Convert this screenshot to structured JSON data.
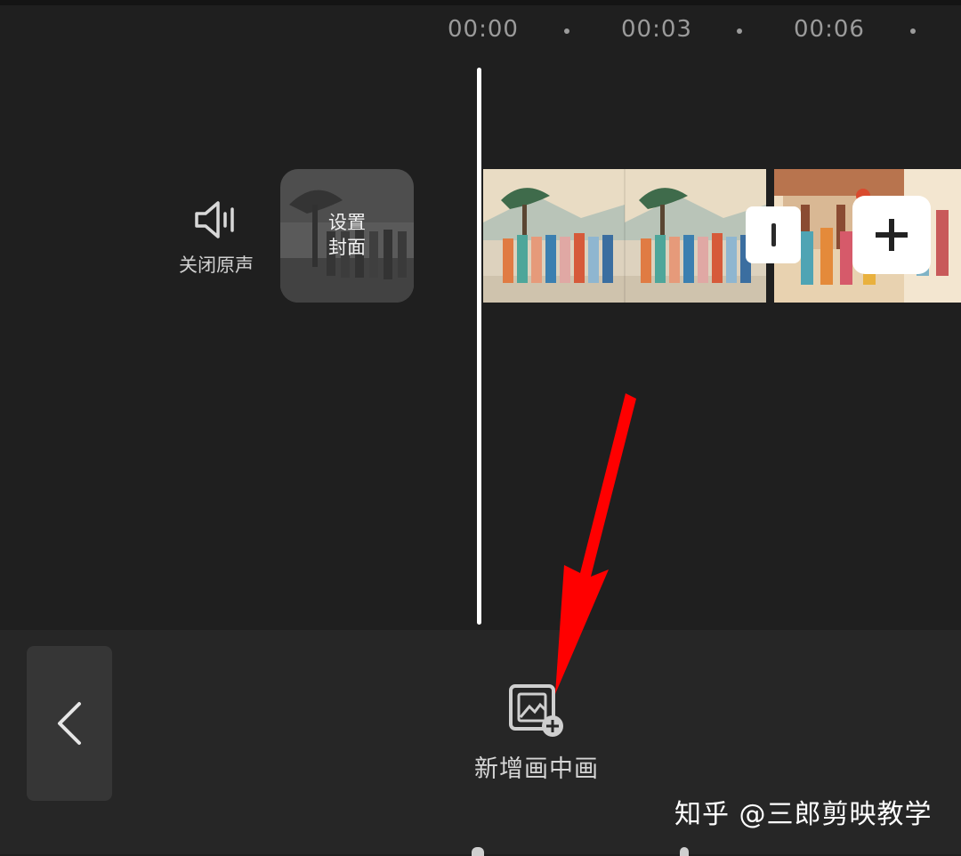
{
  "timeline": {
    "ticks": [
      "00:00",
      "00:03",
      "00:06"
    ]
  },
  "track_controls": {
    "mute_label": "关闭原声",
    "mute_icon": "speaker-icon",
    "cover_label_line1": "设置",
    "cover_label_line2": "封面"
  },
  "clips": {
    "transition_icon": "transition-icon",
    "add_icon": "plus-icon"
  },
  "toolbar": {
    "back_icon": "chevron-left-icon",
    "pip_icon": "picture-in-picture-add-icon",
    "pip_label": "新增画中画"
  },
  "watermark": "知乎 @三郎剪映教学",
  "colors": {
    "background": "#1f1f1f",
    "toolbar": "#262626",
    "playhead": "#ffffff",
    "arrow": "#ff0000"
  }
}
